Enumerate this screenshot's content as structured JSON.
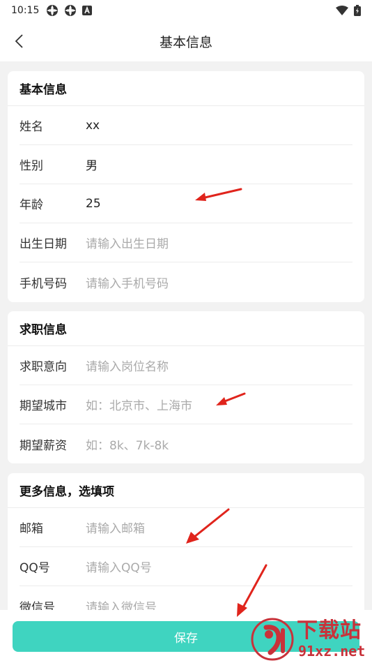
{
  "status_bar": {
    "time": "10:15",
    "icons_left": [
      "sync-icon",
      "sync-icon",
      "notification-a-icon"
    ],
    "icons_right": [
      "wifi-icon",
      "battery-icon"
    ]
  },
  "nav": {
    "title": "基本信息",
    "back_icon": "chevron-left-icon"
  },
  "sections": {
    "basic": {
      "title": "基本信息",
      "rows": [
        {
          "label": "姓名",
          "value": "xx",
          "placeholder": ""
        },
        {
          "label": "性别",
          "value": "男",
          "placeholder": ""
        },
        {
          "label": "年龄",
          "value": "25",
          "placeholder": ""
        },
        {
          "label": "出生日期",
          "value": "",
          "placeholder": "请输入出生日期"
        },
        {
          "label": "手机号码",
          "value": "",
          "placeholder": "请输入手机号码"
        }
      ]
    },
    "job": {
      "title": "求职信息",
      "rows": [
        {
          "label": "求职意向",
          "value": "",
          "placeholder": "请输入岗位名称"
        },
        {
          "label": "期望城市",
          "value": "",
          "placeholder": "如：北京市、上海市"
        },
        {
          "label": "期望薪资",
          "value": "",
          "placeholder": "如：8k、7k-8k"
        }
      ]
    },
    "more": {
      "title": "更多信息，选填项",
      "rows": [
        {
          "label": "邮箱",
          "value": "",
          "placeholder": "请输入邮箱"
        },
        {
          "label": "QQ号",
          "value": "",
          "placeholder": "请输入QQ号"
        },
        {
          "label": "微信号",
          "value": "",
          "placeholder": "请输入微信号"
        }
      ]
    }
  },
  "save_label": "保存",
  "watermark": {
    "title": "下载站",
    "domain": "91xz.net"
  },
  "colors": {
    "accent": "#3fd4c0",
    "arrow": "#e0241c",
    "watermark": "#c8323a",
    "placeholder": "#aaaaaa"
  }
}
